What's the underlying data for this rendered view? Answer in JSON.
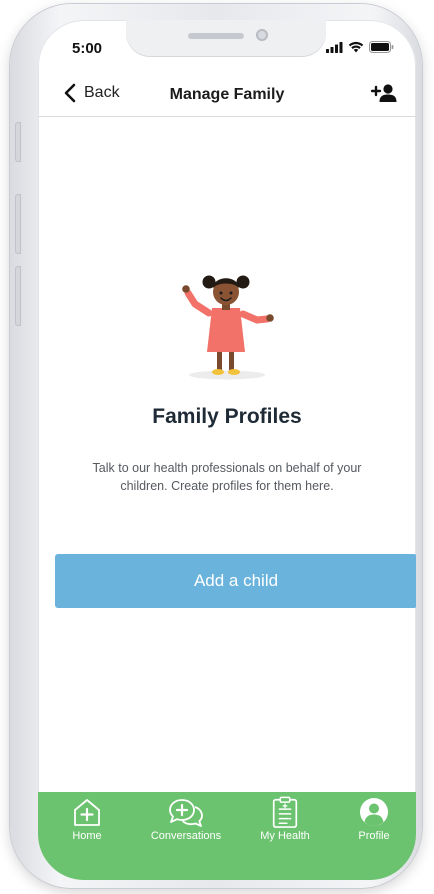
{
  "status_bar": {
    "time": "5:00"
  },
  "nav": {
    "back_label": "Back",
    "title": "Manage Family"
  },
  "main": {
    "heading": "Family Profiles",
    "description": "Talk to our health professionals on behalf of your children. Create profiles for them here.",
    "add_child_label": "Add a child"
  },
  "tab_bar": {
    "items": [
      {
        "label": "Home",
        "icon": "home-plus-icon"
      },
      {
        "label": "Conversations",
        "icon": "chat-bubbles-icon"
      },
      {
        "label": "My Health",
        "icon": "clipboard-icon"
      },
      {
        "label": "Profile",
        "icon": "person-icon"
      }
    ]
  },
  "colors": {
    "accent_button": "#6ab3dc",
    "tab_bar": "#6cc36f",
    "heading_text": "#1e2a35"
  }
}
